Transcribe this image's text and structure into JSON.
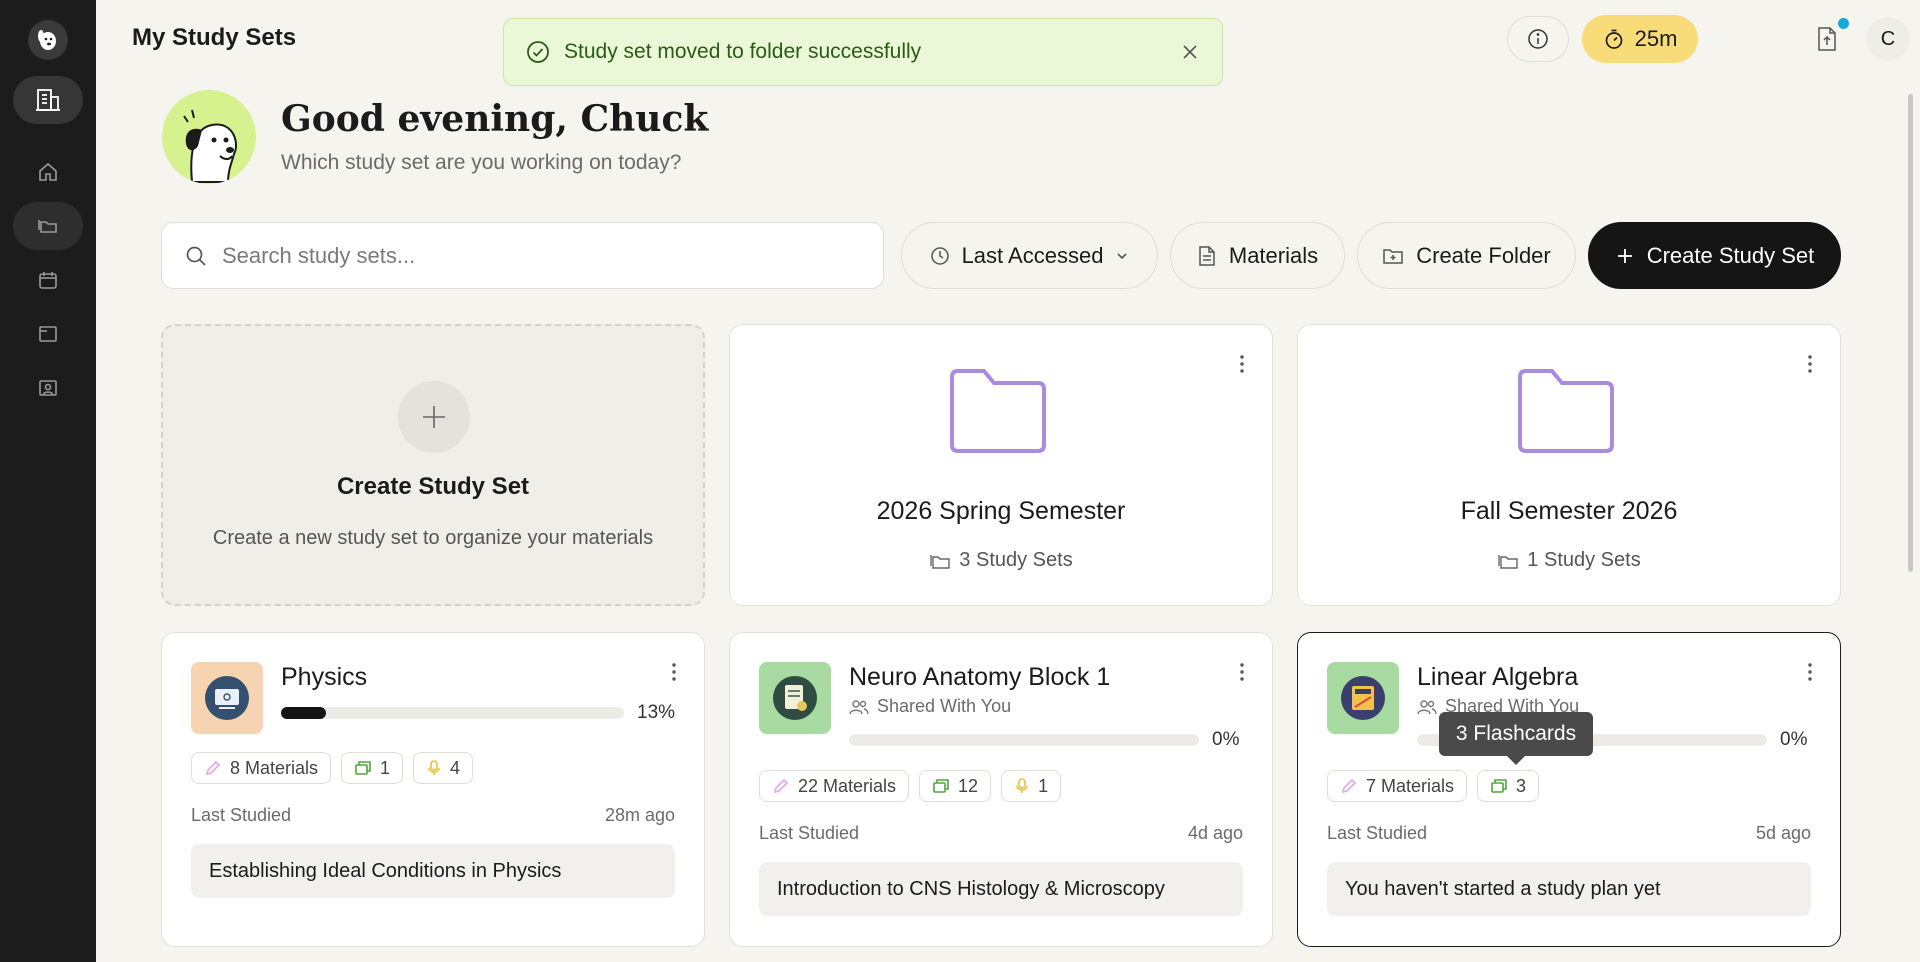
{
  "header": {
    "title": "My Study Sets",
    "timer": "25m",
    "avatar_initial": "C"
  },
  "toast": {
    "message": "Study set moved to folder successfully"
  },
  "greeting": {
    "title": "Good evening, Chuck",
    "subtitle": "Which study set are you working on today?"
  },
  "toolbar": {
    "search_placeholder": "Search study sets...",
    "sort_label": "Last Accessed",
    "materials_label": "Materials",
    "create_folder_label": "Create Folder",
    "create_set_label": "Create Study Set"
  },
  "create_card": {
    "title": "Create Study Set",
    "description": "Create a new study set to organize your materials"
  },
  "folders": [
    {
      "name": "2026 Spring Semester",
      "count": "3 Study Sets"
    },
    {
      "name": "Fall Semester 2026",
      "count": "1 Study Sets"
    }
  ],
  "study_sets": [
    {
      "title": "Physics",
      "shared": "",
      "progress": 13,
      "progress_label": "13%",
      "materials": "8 Materials",
      "flashcards": "1",
      "audio": "4",
      "last_label": "Last Studied",
      "last_value": "28m ago",
      "plan": "Establishing Ideal Conditions in Physics",
      "icon_bg": "#f6d3b1"
    },
    {
      "title": "Neuro Anatomy Block 1",
      "shared": "Shared With You",
      "progress": 0,
      "progress_label": "0%",
      "materials": "22 Materials",
      "flashcards": "12",
      "audio": "1",
      "last_label": "Last Studied",
      "last_value": "4d ago",
      "plan": "Introduction to CNS Histology & Microscopy",
      "icon_bg": "#a8dba1"
    },
    {
      "title": "Linear Algebra",
      "shared": "Shared With You",
      "progress": 0,
      "progress_label": "0%",
      "materials": "7 Materials",
      "flashcards": "3",
      "last_label": "Last Studied",
      "last_value": "5d ago",
      "plan": "You haven't started a study plan yet",
      "icon_bg": "#a8dba1"
    }
  ],
  "tooltip": {
    "text": "3 Flashcards"
  },
  "colors": {
    "accent_dark": "#151515",
    "toast_bg": "#ebf8d8",
    "timer_bg": "#f9dc7a",
    "folder_stroke": "#a98be0",
    "mascot_bg": "#d6f28e"
  }
}
